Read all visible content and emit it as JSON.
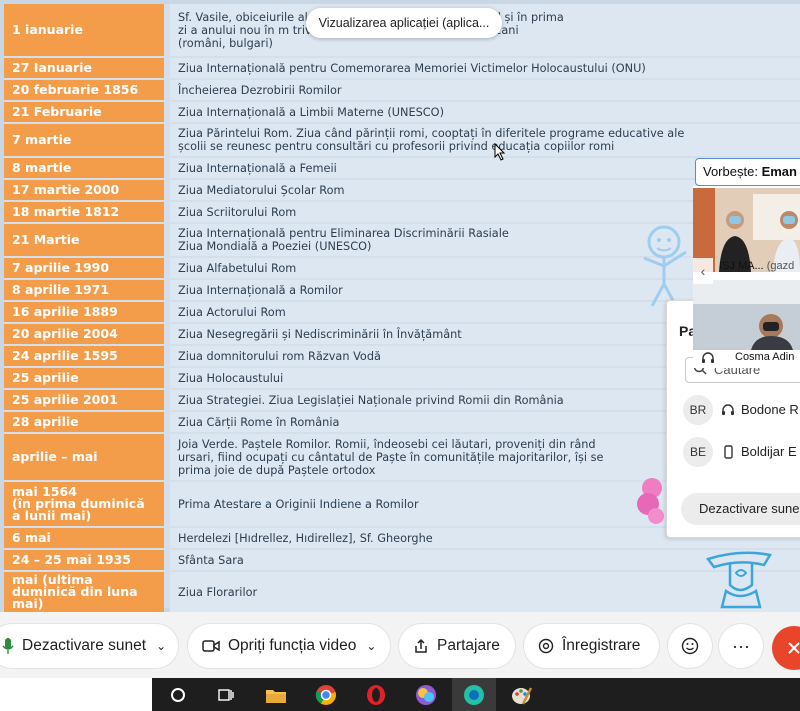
{
  "tooltip": "Vizualizarea aplicației (aplica...",
  "table": [
    {
      "date": "1 ianuarie",
      "desc": "Sf. Vasile, obiceiurile        al \"cu Vasilca\" este întâlnit în ajunul și în prima\nzi a anului nou în m             trivă, de romi și de alte etnii din Balcani\n(români, bulgari)"
    },
    {
      "date": "27 Ianuarie",
      "desc": "Ziua Internațională pentru Comemorarea Memoriei Victimelor Holocaustului (ONU)"
    },
    {
      "date": "20 februarie 1856",
      "desc": "Încheierea Dezrobirii Romilor"
    },
    {
      "date": "21 Februarie",
      "desc": "Ziua Internațională a Limbii Materne (UNESCO)"
    },
    {
      "date": "7 martie",
      "desc": "Ziua Părintelui Rom. Ziua când părinții romi, cooptați în diferitele programe educative ale\nșcolii se reunesc pentru consultări cu profesorii privind educația copiilor romi"
    },
    {
      "date": "8 martie",
      "desc": "Ziua Internațională a Femeii"
    },
    {
      "date": "17 martie 2000",
      "desc": "Ziua Mediatorului Școlar Rom"
    },
    {
      "date": "18 martie 1812",
      "desc": "Ziua Scriitorului Rom"
    },
    {
      "date": "21 Martie",
      "desc": "Ziua Internațională pentru Eliminarea Discriminării Rasiale\nZiua Mondială a Poeziei (UNESCO)"
    },
    {
      "date": "7 aprilie 1990",
      "desc": "Ziua Alfabetului Rom"
    },
    {
      "date": "8 aprilie 1971",
      "desc": "Ziua Internațională a Romilor"
    },
    {
      "date": "16 aprilie 1889",
      "desc": "Ziua Actorului Rom"
    },
    {
      "date": "20 aprilie 2004",
      "desc": "Ziua Nesegregării și Nediscriminării în Învățământ"
    },
    {
      "date": "24 aprilie 1595",
      "desc": "Ziua domnitorului rom Răzvan Vodă"
    },
    {
      "date": "25 aprilie",
      "desc": "Ziua Holocaustului"
    },
    {
      "date": "25 aprilie 2001",
      "desc": "Ziua Strategiei. Ziua Legislației Naționale privind Romii din România"
    },
    {
      "date": "28 aprilie",
      "desc": "Ziua Cărții Rome în România"
    },
    {
      "date": "aprilie – mai",
      "desc": "Joia Verde. Paștele Romilor. Romii, îndeosebi cei lăutari, proveniți din rând\nursari, fiind ocupați cu cântatul de Paște în comunitățile majoritarilor, își se\nprima joie de după Paștele ortodox"
    },
    {
      "date": "mai 1564\n(în prima duminică\na lunii mai)",
      "desc": "Prima Atestare a Originii Indiene a Romilor"
    },
    {
      "date": "6 mai",
      "desc": "Herdelezi [Hıdrellez, Hıdirellez], Sf. Gheorghe"
    },
    {
      "date": "24 – 25 mai 1935",
      "desc": "Sfânta Sara"
    },
    {
      "date": "mai (ultima\nduminică din luna\nmai)",
      "desc": "Ziua Florarilor"
    }
  ],
  "speaking": {
    "label": "Vorbește:",
    "name": "Eman"
  },
  "videos": [
    {
      "label": "ISJ MA...",
      "suffix": "(gazd"
    },
    {
      "label": "Cosma Adin"
    }
  ],
  "participants": {
    "title": "Pa",
    "search_placeholder": "Căutare",
    "items": [
      {
        "initials": "BR",
        "name": "Bodone R"
      },
      {
        "initials": "BE",
        "name": "Boldijar E"
      }
    ],
    "mute_label": "Dezactivare sune"
  },
  "toolbar": {
    "mute": "Dezactivare sunet",
    "video": "Opriți funcția video",
    "share": "Partajare",
    "record": "Înregistrare"
  },
  "colors": {
    "date_cell": "#f39c4a",
    "desc_cell": "#dde7f1",
    "end_button": "#e8452b",
    "mic_green": "#2e8b3d"
  }
}
